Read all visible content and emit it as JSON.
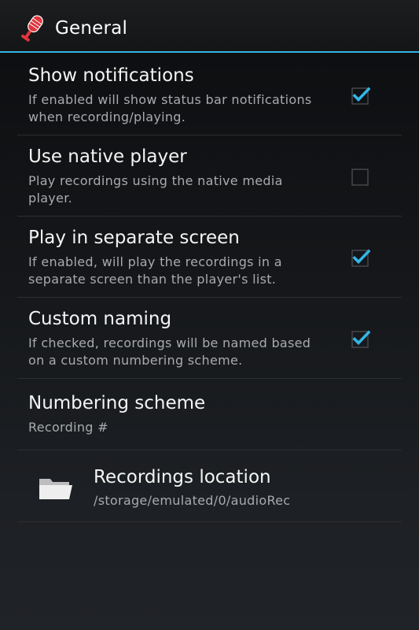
{
  "action_bar": {
    "title": "General",
    "icon": "microphone-icon",
    "accent_color": "#33b5e5"
  },
  "preferences": [
    {
      "title": "Show notifications",
      "summary": "If enabled will show status bar notifications when recording/playing.",
      "checked": true
    },
    {
      "title": "Use native player",
      "summary": "Play recordings using the native media player.",
      "checked": false
    },
    {
      "title": "Play in separate screen",
      "summary": "If enabled, will play the recordings in a separate screen than the player's list.",
      "checked": true
    },
    {
      "title": "Custom naming",
      "summary": "If checked, recordings will be named based on a custom numbering scheme.",
      "checked": true
    },
    {
      "title": "Numbering scheme",
      "summary": "Recording #"
    },
    {
      "title": "Recordings location",
      "summary": "/storage/emulated/0/audioRec",
      "icon": "folder-icon"
    }
  ],
  "colors": {
    "check": "#33b5e5",
    "checkbox_border": "#45474c"
  }
}
